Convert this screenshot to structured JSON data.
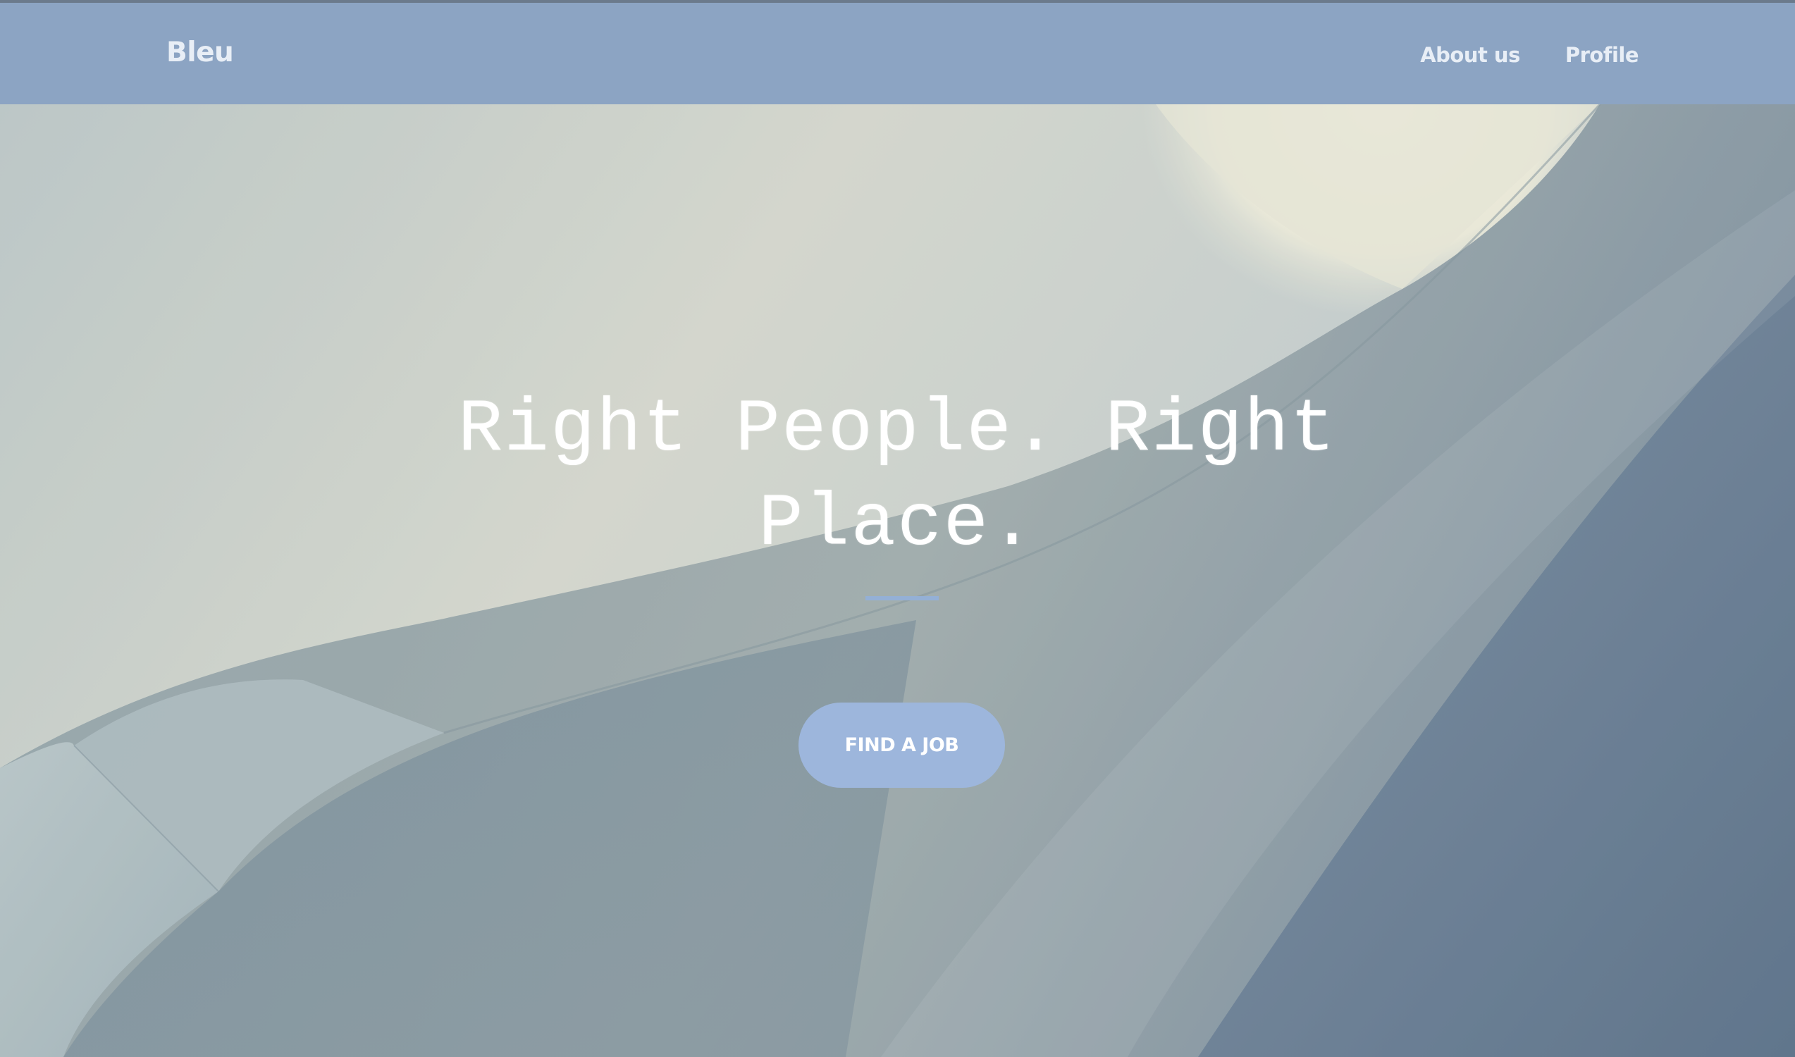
{
  "nav": {
    "brand": "Bleu",
    "links": [
      {
        "label": "About us"
      },
      {
        "label": "Profile"
      }
    ]
  },
  "hero": {
    "headline": "Right People. Right Place.",
    "cta_label": "FIND A JOB"
  },
  "colors": {
    "navbar": "#8ca4c3",
    "accent": "#9db6dc",
    "divider": "#94b0d6",
    "text_light": "#e8eef6"
  }
}
